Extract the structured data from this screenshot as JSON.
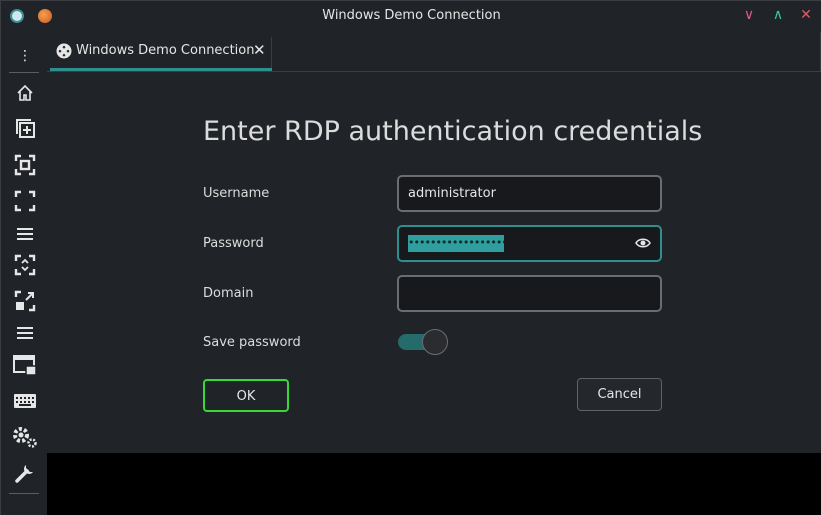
{
  "window": {
    "title": "Windows Demo Connection"
  },
  "tab": {
    "label": "Windows Demo Connection",
    "close_symbol": "✕"
  },
  "window_controls": {
    "minimize": "∨",
    "maximize": "∧",
    "close": "✕"
  },
  "sidebar": {
    "menu_symbol": "⋮",
    "items": [
      {
        "icon": "home-icon"
      },
      {
        "icon": "new-window-icon"
      },
      {
        "icon": "fullscreen-icon"
      },
      {
        "icon": "fit-window-icon"
      },
      {
        "icon": "menu-icon"
      },
      {
        "icon": "scale-icon"
      },
      {
        "icon": "resize-icon"
      },
      {
        "icon": "list-icon"
      },
      {
        "icon": "display-icon"
      },
      {
        "icon": "keyboard-icon"
      },
      {
        "icon": "settings-icon"
      },
      {
        "icon": "tools-icon"
      }
    ]
  },
  "dialog": {
    "heading": "Enter RDP authentication credentials",
    "username_label": "Username",
    "username_value": "administrator",
    "password_label": "Password",
    "password_value": "••••••••••••••••••••",
    "domain_label": "Domain",
    "domain_value": "",
    "save_password_label": "Save password",
    "save_password_enabled": true,
    "ok_label": "OK",
    "cancel_label": "Cancel"
  },
  "colors": {
    "accent": "#2e8f8f",
    "focus_button_border": "#38d838",
    "background": "#202328"
  }
}
